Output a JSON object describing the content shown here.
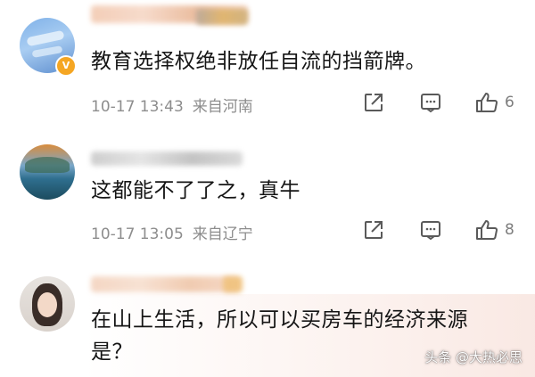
{
  "comments": [
    {
      "text": "教育选择权绝非放任自流的挡箭牌。",
      "time": "10-17 13:43",
      "location": "来自河南",
      "likes": "6",
      "verified_badge": "V",
      "avatar_icon": "sky-avatar"
    },
    {
      "text": "这都能不了了之，真牛",
      "time": "10-17 13:05",
      "location": "来自辽宁",
      "likes": "8",
      "avatar_icon": "lake-avatar"
    },
    {
      "text_line1": "在山上生活，所以可以买房车的经济来源",
      "text_line2": "是？",
      "avatar_icon": "girl-avatar"
    }
  ],
  "watermark": "头条 @大热必思",
  "icons": [
    "share-icon",
    "comment-icon",
    "like-icon"
  ]
}
